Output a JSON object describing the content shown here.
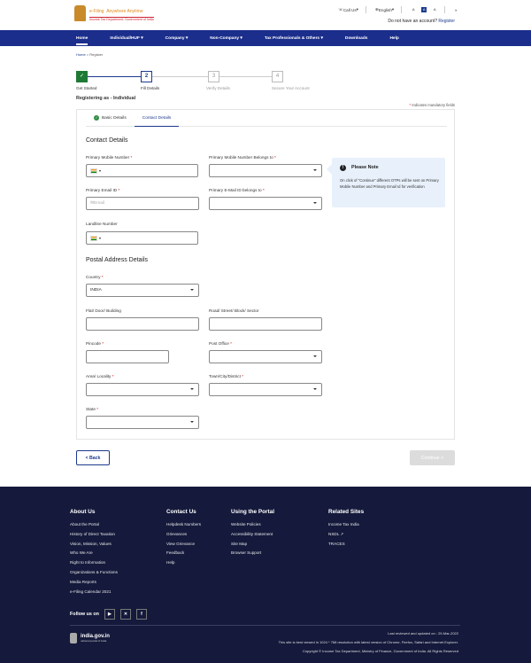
{
  "header": {
    "logo_title": "e-Filing",
    "logo_tag": "Anywhere Anytime",
    "logo_sub": "Income Tax Department, Government of India",
    "call_us": "Call Us",
    "language": "English",
    "acc_a_minus": "A",
    "acc_a": "A",
    "acc_a_plus": "A",
    "no_account": "Do not have an account?",
    "register_link": "Register"
  },
  "nav": [
    "Home",
    "Individual/HUF",
    "Company",
    "Non-Company",
    "Tax Professionals & Others",
    "Downloads",
    "Help"
  ],
  "breadcrumb": {
    "home": "Home",
    "sep": " > ",
    "current": "Register"
  },
  "steps": [
    {
      "num": "✓",
      "label": "Get Started"
    },
    {
      "num": "2",
      "label": "Fill Details"
    },
    {
      "num": "3",
      "label": "Verify Details"
    },
    {
      "num": "4",
      "label": "Secure Your Account"
    }
  ],
  "registering_as": "Registering as -  Individual",
  "mandatory_note": "Indicates mandatory fields",
  "tabs": {
    "basic": "Basic Details",
    "contact": "Contact Details"
  },
  "contact": {
    "heading": "Contact Details",
    "mobile_label": "Primary Mobile Number",
    "mobile_prefix": "▾",
    "mobile_belongs_label": "Primary Mobile Number Belongs to",
    "email_label": "Primary Email ID",
    "email_placeholder": "Email",
    "email_belongs_label": "Primary E-Mail ID belongs to",
    "landline_label": "Landline Number",
    "landline_prefix": "▾"
  },
  "note": {
    "title": "Please Note",
    "body": "On click of \"Continue\" different OTPs will be sent on Primary Mobile Number and Primary Email Id for verification"
  },
  "address": {
    "heading": "Postal Address Details",
    "country_label": "Country",
    "country_value": "INDIA",
    "flat_label": "Flat/ Door/ Building",
    "road_label": "Road/ Street/ Block/ Sector",
    "pincode_label": "Pincode",
    "po_label": "Post Office",
    "area_label": "Area/ Locality",
    "town_label": "Town/City/District",
    "state_label": "State"
  },
  "buttons": {
    "back": "< Back",
    "continue": "Continue >"
  },
  "footer": {
    "about": {
      "title": "About Us",
      "items": [
        "About the Portal",
        "History of Direct Taxation",
        "Vision, Mission, Values",
        "Who We Are",
        "Right to Information",
        "Organizations & Functions",
        "Media Reports",
        "e-Filing Calendar 2021"
      ]
    },
    "contact": {
      "title": "Contact Us",
      "items": [
        "Helpdesk Numbers",
        "Grievances",
        "View Grievance",
        "Feedback",
        "Help"
      ]
    },
    "using": {
      "title": "Using the Portal",
      "items": [
        "Website Policies",
        "Accessibility Statement",
        "Site Map",
        "Browser Support"
      ]
    },
    "related": {
      "title": "Related Sites",
      "items": [
        "Income Tax India",
        "NSDL ↗",
        "TRACES"
      ]
    },
    "follow": "Follow us on",
    "india_title": "india.gov.in",
    "india_sub": "national portal of india",
    "last_reviewed": "Last reviewed and updated on : 29-Mar-2022",
    "best_viewed": "This site is best viewed in 1024 * 768 resolution with latest version of Chrome, Firefox, Safari and Internet Explorer.",
    "copyright": "Copyright © Income Tax Department, Ministry of Finance, Government of India. All Rights Reserved"
  }
}
